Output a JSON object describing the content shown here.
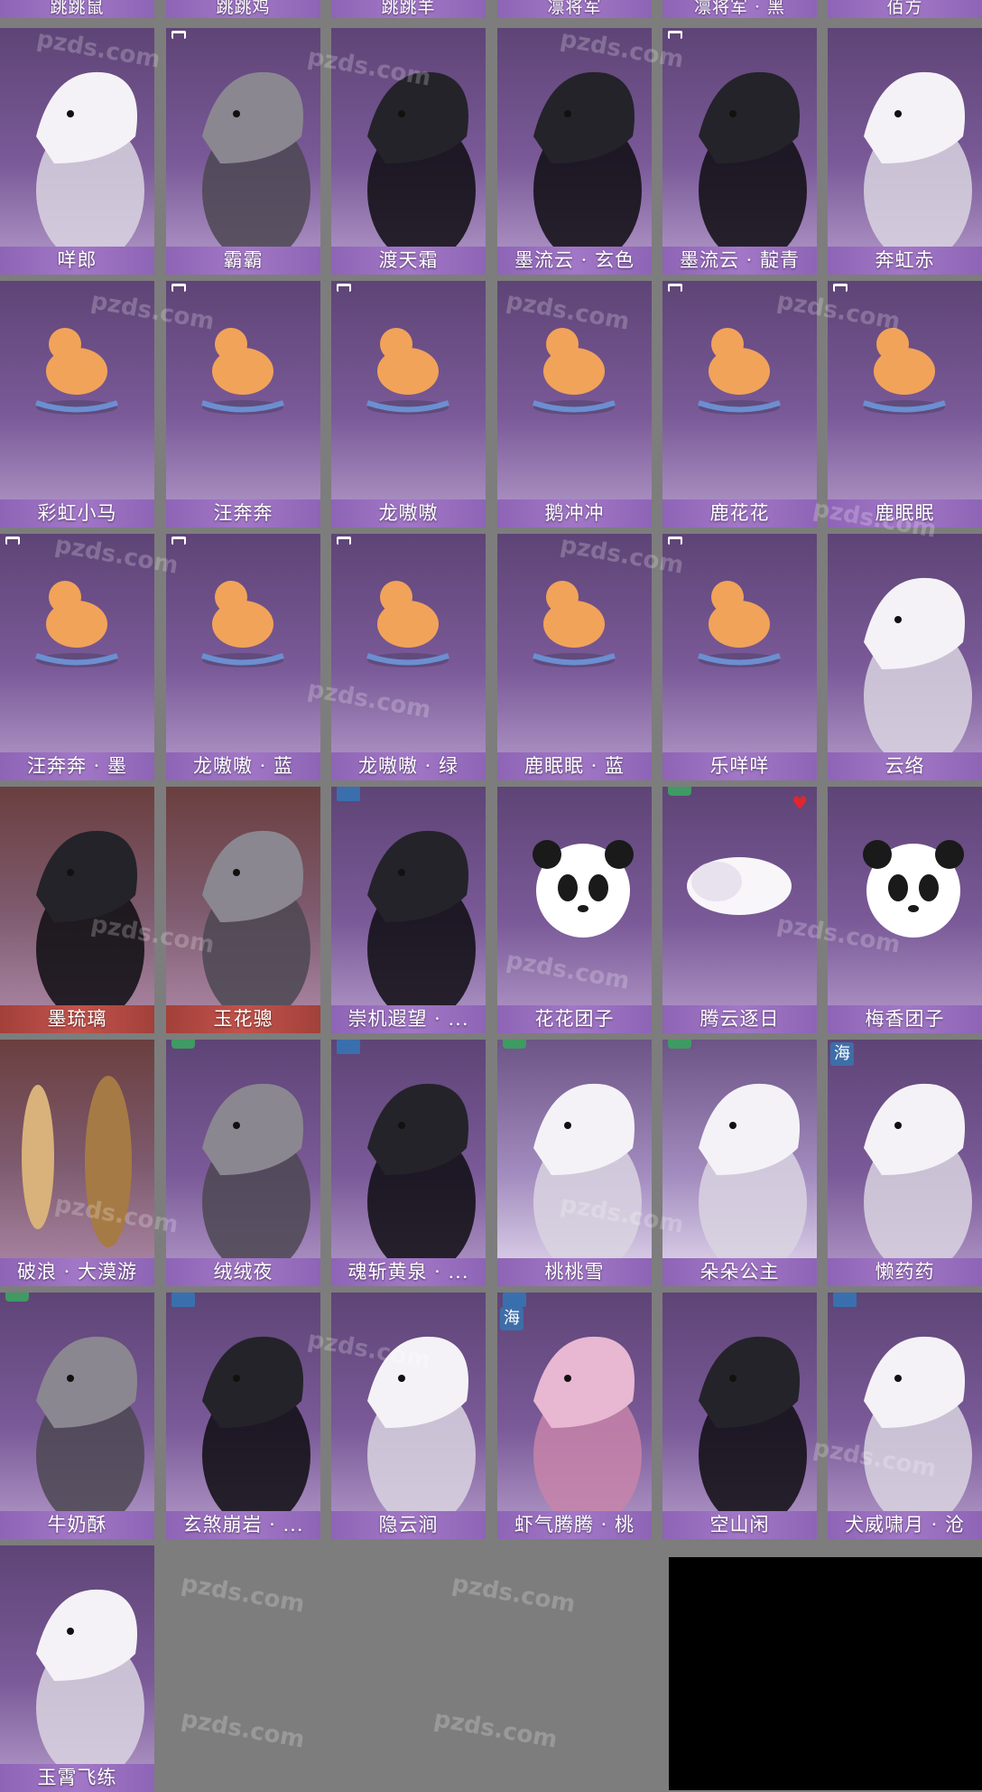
{
  "watermark": "pzds.com",
  "top_row": [
    "跳跳鼠",
    "跳跳鸡",
    "跳跳羊",
    "凛将军",
    "凛将军 · 黑",
    "佰方"
  ],
  "cards": [
    {
      "label": "咩郎",
      "badge": "",
      "icon": "poodle-icon",
      "art": "white"
    },
    {
      "label": "霸霸",
      "badge": "white",
      "icon": "husky-icon",
      "art": "gray"
    },
    {
      "label": "渡天霜",
      "badge": "",
      "icon": "dark-horse-icon",
      "art": "dark"
    },
    {
      "label": "墨流云 · 玄色",
      "badge": "",
      "icon": "black-horse-icon",
      "art": "dark"
    },
    {
      "label": "墨流云 · 靛青",
      "badge": "white",
      "icon": "black-horse-icon",
      "art": "dark"
    },
    {
      "label": "奔虹赤",
      "badge": "",
      "icon": "white-horse-icon",
      "art": "white"
    },
    {
      "label": "彩虹小马",
      "badge": "",
      "icon": "rocking-pony-icon",
      "art": "toy"
    },
    {
      "label": "汪奔奔",
      "badge": "white",
      "icon": "rocking-dog-icon",
      "art": "toy"
    },
    {
      "label": "龙嗷嗷",
      "badge": "white",
      "icon": "rocking-dragon-icon",
      "art": "toy"
    },
    {
      "label": "鹅冲冲",
      "badge": "",
      "icon": "rocking-goose-icon",
      "art": "toy"
    },
    {
      "label": "鹿花花",
      "badge": "white",
      "icon": "rocking-giraffe-icon",
      "art": "toy"
    },
    {
      "label": "鹿眠眠",
      "badge": "white",
      "icon": "rocking-deer-icon",
      "art": "toy"
    },
    {
      "label": "汪奔奔 · 墨",
      "badge": "white",
      "icon": "rocking-dog-icon",
      "art": "toy"
    },
    {
      "label": "龙嗷嗷 · 蓝",
      "badge": "white",
      "icon": "rocking-dragon-icon",
      "art": "toy"
    },
    {
      "label": "龙嗷嗷 · 绿",
      "badge": "white",
      "icon": "rocking-dragon-icon",
      "art": "toy"
    },
    {
      "label": "鹿眠眠 · 蓝",
      "badge": "",
      "icon": "rocking-deer-icon",
      "art": "toy"
    },
    {
      "label": "乐咩咩",
      "badge": "white",
      "icon": "rocking-sheep-icon",
      "art": "toy"
    },
    {
      "label": "云络",
      "badge": "",
      "icon": "white-horse-icon",
      "art": "white"
    },
    {
      "label": "墨琉璃",
      "badge": "",
      "icon": "black-horse-icon",
      "art": "dark",
      "warm": true,
      "red": true
    },
    {
      "label": "玉花骢",
      "badge": "",
      "icon": "gray-horse-icon",
      "art": "gray",
      "warm": true,
      "red": true
    },
    {
      "label": "崇机遐望 · ...",
      "badge": "blue",
      "icon": "mech-mount-icon",
      "art": "dark"
    },
    {
      "label": "花花团子",
      "badge": "",
      "icon": "panda-icon",
      "art": "panda"
    },
    {
      "label": "腾云逐日",
      "badge": "green",
      "icon": "cloud-icon",
      "art": "cloud",
      "heart": true
    },
    {
      "label": "梅香团子",
      "badge": "",
      "icon": "panda-icon",
      "art": "panda"
    },
    {
      "label": "破浪 · 大漠游",
      "badge": "",
      "icon": "surfboard-icon",
      "art": "board",
      "warm": true
    },
    {
      "label": "绒绒夜",
      "badge": "green",
      "icon": "rabbit-icon",
      "art": "gray"
    },
    {
      "label": "魂斩黄泉 · ...",
      "badge": "blue",
      "icon": "black-hound-icon",
      "art": "dark"
    },
    {
      "label": "桃桃雪",
      "badge": "green",
      "icon": "fluffy-icon",
      "art": "white",
      "pale": true
    },
    {
      "label": "朵朵公主",
      "badge": "green",
      "icon": "fluffy-icon",
      "art": "white",
      "pale": true
    },
    {
      "label": "懒药药",
      "badge": "",
      "tag": "海",
      "icon": "polar-bear-icon",
      "art": "white"
    },
    {
      "label": "牛奶酥",
      "badge": "green",
      "icon": "cat-icon",
      "art": "gray"
    },
    {
      "label": "玄煞崩岩 · ...",
      "badge": "blue",
      "icon": "black-ox-icon",
      "art": "dark"
    },
    {
      "label": "隐云涧",
      "badge": "",
      "icon": "white-donkey-icon",
      "art": "white"
    },
    {
      "label": "虾气腾腾 · 桃",
      "badge": "blue",
      "tag": "海",
      "icon": "shrimp-icon",
      "art": "pink"
    },
    {
      "label": "空山闲",
      "badge": "",
      "icon": "black-donkey-icon",
      "art": "dark"
    },
    {
      "label": "犬威啸月 · 沧",
      "badge": "blue",
      "icon": "white-wolf-icon",
      "art": "white"
    },
    {
      "label": "玉霄飞练",
      "badge": "",
      "icon": "white-cat-icon",
      "art": "white"
    }
  ]
}
